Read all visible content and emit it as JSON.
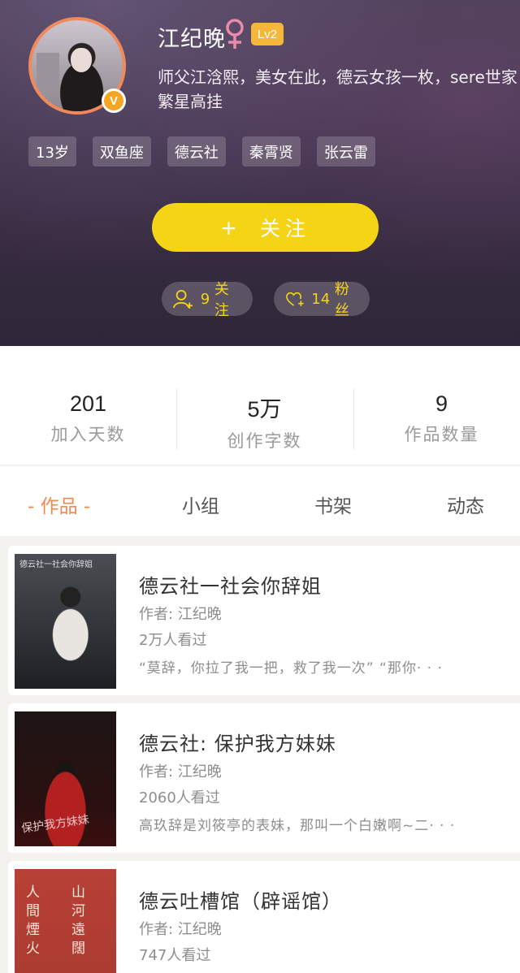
{
  "profile": {
    "name": "江纪晚",
    "gender_icon": "female-icon",
    "level": "Lv2",
    "verified_badge": "V",
    "bio_line1": "师父江浛熙，美女在此，德云女孩一枚，sere世家",
    "bio_line2": "繁星高挂",
    "tags": [
      "13岁",
      "双鱼座",
      "德云社",
      "秦霄贤",
      "张云雷"
    ],
    "follow_button": {
      "plus": "+",
      "label": "关注"
    },
    "following": {
      "count": "9",
      "label": "关注"
    },
    "fans": {
      "count": "14",
      "label": "粉丝"
    }
  },
  "stats": [
    {
      "value": "201",
      "label": "加入天数"
    },
    {
      "value": "5万",
      "label": "创作字数"
    },
    {
      "value": "9",
      "label": "作品数量"
    }
  ],
  "tabs": [
    "- 作品 -",
    "小组",
    "书架",
    "动态"
  ],
  "works": [
    {
      "title": "德云社一社会你辞姐",
      "author": "作者: 江纪晚",
      "views": "2万人看过",
      "excerpt": "“莫辞，你拉了我一把，救了我一次” “那你· · ·",
      "cover_text": "德云社一社会你辞姐"
    },
    {
      "title": "德云社: 保护我方妹妹",
      "author": "作者: 江纪晚",
      "views": "2060人看过",
      "excerpt": "高玖辞是刘筱亭的表妹，那叫一个白嫩啊~二· · ·",
      "cover_text": "保护我方妹妹"
    },
    {
      "title": "德云吐槽馆（辟谣馆）",
      "author": "作者: 江纪晚",
      "views": "747人看过",
      "excerpt": "",
      "cover_text_left": "人間煙火",
      "cover_text_right": "山河遠闊"
    }
  ],
  "colors": {
    "accent_yellow": "#f5d416",
    "accent_orange": "#f0884f",
    "level_badge": "#f4b73a"
  }
}
